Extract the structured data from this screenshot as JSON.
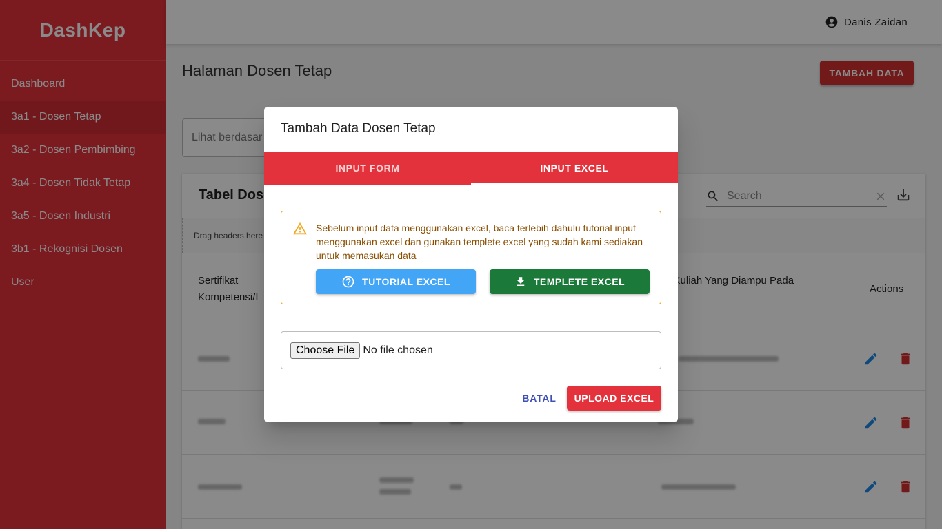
{
  "app": {
    "brand": "DashKep"
  },
  "sidebar": {
    "items": [
      {
        "label": "Dashboard"
      },
      {
        "label": "3a1 - Dosen Tetap"
      },
      {
        "label": "3a2 - Dosen Pembimbing"
      },
      {
        "label": "3a4 - Dosen Tidak Tetap"
      },
      {
        "label": "3a5 - Dosen Industri"
      },
      {
        "label": "3b1 - Rekognisi Dosen"
      },
      {
        "label": "User"
      }
    ]
  },
  "topbar": {
    "user_name": "Danis Zaidan"
  },
  "page": {
    "title": "Halaman Dosen Tetap",
    "add_button": "TAMBAH DATA",
    "filter_placeholder": "Lihat berdasar"
  },
  "table": {
    "title": "Tabel Dose",
    "search_placeholder": "Search",
    "group_hint": "Drag headers here",
    "headers": {
      "col1": "Sertifikat\nKompetensi/I",
      "col2": "a Kuliah Yang Diampu Pada\nain",
      "actions": "Actions"
    }
  },
  "dialog": {
    "title": "Tambah Data Dosen Tetap",
    "tabs": [
      {
        "label": "INPUT FORM"
      },
      {
        "label": "INPUT EXCEL"
      }
    ],
    "alert_text": "Sebelum input data menggunakan excel, baca terlebih dahulu tutorial input menggunakan excel dan gunakan templete excel yang sudah kami sediakan untuk memasukan data",
    "tutorial_button": "TUTORIAL EXCEL",
    "template_button": "TEMPLETE EXCEL",
    "file_button": "Choose File",
    "file_status": "No file chosen",
    "cancel_button": "BATAL",
    "upload_button": "UPLOAD EXCEL"
  },
  "colors": {
    "brand_red": "#e3323b",
    "tutorial_blue": "#42a5f5",
    "template_green": "#1b7a3a",
    "alert_orange": "#f1a925",
    "cancel_indigo": "#3f51b5"
  },
  "icons": {
    "user": "account-circle-icon",
    "search": "search-icon",
    "clear": "close-icon",
    "download": "download-icon",
    "warning": "warning-icon",
    "help": "help-circle-icon",
    "edit": "pencil-icon",
    "delete": "trash-icon"
  }
}
